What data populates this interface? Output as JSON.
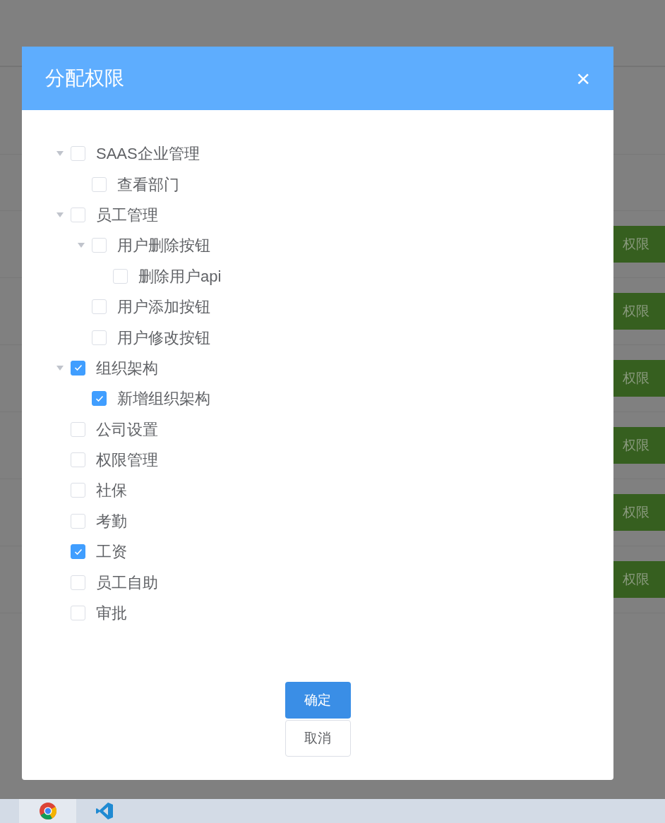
{
  "background": {
    "row_buttons": [
      {
        "label": "权限"
      },
      {
        "label": "权限"
      },
      {
        "label": "权限"
      },
      {
        "label": "权限"
      },
      {
        "label": "权限"
      },
      {
        "label": "权限"
      }
    ]
  },
  "dialog": {
    "title": "分配权限",
    "close": "×",
    "tree": [
      {
        "label": "SAAS企业管理",
        "checked": false,
        "expanded": true,
        "children": [
          {
            "label": "查看部门",
            "checked": false
          }
        ]
      },
      {
        "label": "员工管理",
        "checked": false,
        "expanded": true,
        "children": [
          {
            "label": "用户删除按钮",
            "checked": false,
            "expanded": true,
            "children": [
              {
                "label": "删除用户api",
                "checked": false
              }
            ]
          },
          {
            "label": "用户添加按钮",
            "checked": false
          },
          {
            "label": "用户修改按钮",
            "checked": false
          }
        ]
      },
      {
        "label": "组织架构",
        "checked": true,
        "expanded": true,
        "children": [
          {
            "label": "新增组织架构",
            "checked": true
          }
        ]
      },
      {
        "label": "公司设置",
        "checked": false
      },
      {
        "label": "权限管理",
        "checked": false
      },
      {
        "label": "社保",
        "checked": false
      },
      {
        "label": "考勤",
        "checked": false
      },
      {
        "label": "工资",
        "checked": true
      },
      {
        "label": "员工自助",
        "checked": false
      },
      {
        "label": "审批",
        "checked": false
      }
    ],
    "buttons": [
      {
        "label": "确定",
        "kind": "primary"
      },
      {
        "label": "取消",
        "kind": "default"
      }
    ]
  }
}
